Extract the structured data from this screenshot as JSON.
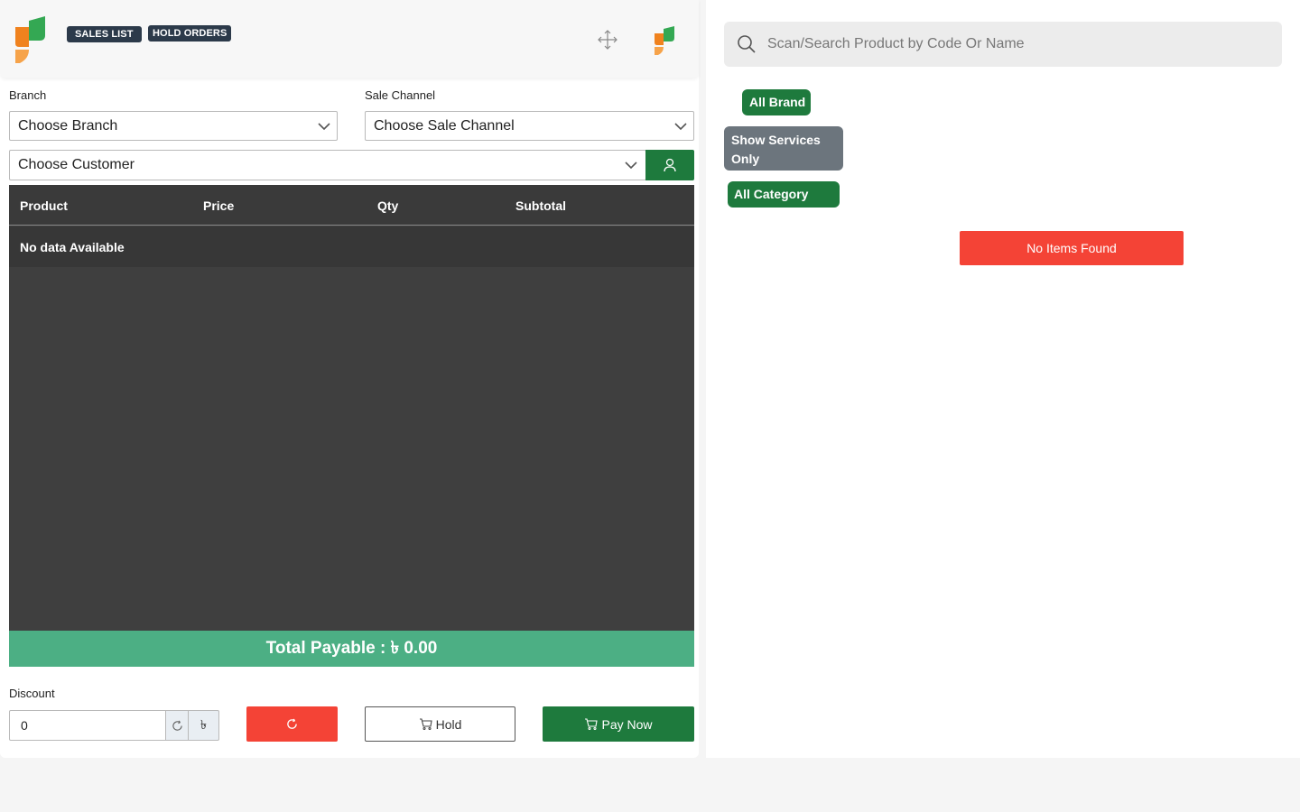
{
  "header": {
    "sales_list_label": "SALES LIST",
    "hold_orders_label": "HOLD ORDERS"
  },
  "form": {
    "branch_label": "Branch",
    "branch_value": "Choose Branch",
    "sale_channel_label": "Sale Channel",
    "sale_channel_value": "Choose Sale Channel",
    "customer_value": "Choose Customer"
  },
  "table": {
    "columns": [
      "Product",
      "Price",
      "Qty",
      "Subtotal"
    ],
    "empty_text": "No data Available"
  },
  "total": {
    "text": "Total Payable : ৳ 0.00"
  },
  "discount": {
    "label": "Discount",
    "value": "0",
    "currency_symbol": "৳"
  },
  "actions": {
    "hold_label": "Hold",
    "pay_label": "Pay Now"
  },
  "search": {
    "placeholder": "Scan/Search Product by Code Or Name"
  },
  "filters": {
    "brand_label": "All Brand",
    "services_label": "Show Services Only",
    "category_label": "All Category"
  },
  "results": {
    "empty_text": "No Items Found"
  },
  "colors": {
    "primary_green": "#1e7a3d",
    "total_green": "#4caf84",
    "danger_red": "#f44336",
    "badge_dark": "#2c3a4a",
    "logo_green": "#34a853",
    "logo_orange": "#f0821e"
  }
}
